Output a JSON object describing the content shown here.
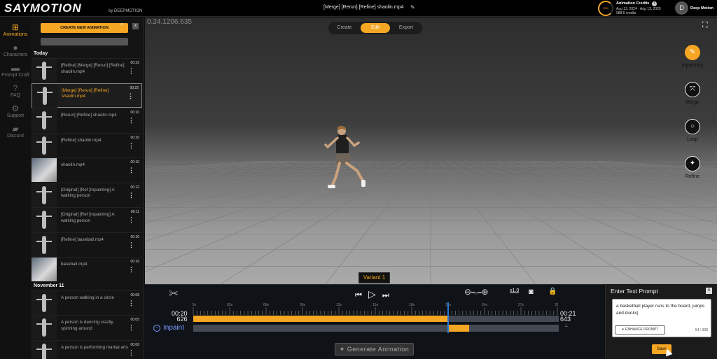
{
  "header": {
    "logo": "SAYMOTION",
    "logo_sub": "by DEEPMOTION",
    "filename": "[Merge] [Rerun] [Refine] shaolin.mp4",
    "credits": {
      "title": "Animation Credits",
      "ring_label": "99%",
      "date_range": "Aug 13, 2024 - Aug 13, 2025",
      "remaining": "988.5 credits"
    },
    "avatar_initial": "D",
    "username": "Deep Motion"
  },
  "left_nav": {
    "items": [
      {
        "label": "Animations",
        "icon": "plus-square-icon",
        "active": true
      },
      {
        "label": "Characters",
        "icon": "person-icon",
        "active": false
      },
      {
        "label": "Prompt Craft",
        "icon": "vr-headset-icon",
        "active": false
      },
      {
        "label": "FAQ",
        "icon": "question-icon",
        "active": false
      },
      {
        "label": "Support",
        "icon": "gear-icon",
        "active": false
      },
      {
        "label": "Discord",
        "icon": "chat-icon",
        "active": false
      }
    ]
  },
  "panel": {
    "create_button": "CREATE NEW ANIMATION",
    "close": "x",
    "search_placeholder": "",
    "groups": [
      {
        "label": "Today",
        "items": [
          {
            "title": "[Refine] [Merge] [Rerun] [Refine] shaolin.mp4",
            "time": "00:22",
            "thumb": "tpose",
            "selected": false
          },
          {
            "title": "[Merge] [Rerun] [Refine] shaolin.mp4",
            "time": "00:22",
            "thumb": "tpose",
            "selected": true
          },
          {
            "title": "[Rerun] [Refine] shaolin.mp4",
            "time": "00:10",
            "thumb": "tpose",
            "selected": false
          },
          {
            "title": "[Refine] shaolin.mp4",
            "time": "00:10",
            "thumb": "tpose",
            "selected": false
          },
          {
            "title": "shaolin.mp4",
            "time": "00:10",
            "thumb": "photo",
            "selected": false
          },
          {
            "title": "[Original] [Ref [Inpainting] A walking person",
            "time": "00:12",
            "thumb": "tpose",
            "selected": false
          },
          {
            "title": "[Original] [Ref [Inpainting] A walking person",
            "time": "00:11",
            "thumb": "tpose",
            "selected": false
          },
          {
            "title": "[Refine] baseball.mp4",
            "time": "00:16",
            "thumb": "tpose",
            "selected": false
          },
          {
            "title": "baseball.mp4",
            "time": "00:16",
            "thumb": "photo",
            "selected": false
          }
        ]
      },
      {
        "label": "November 11",
        "items": [
          {
            "title": "A person walking in a circle",
            "time": "00:08",
            "thumb": "tpose",
            "selected": false
          },
          {
            "title": "A person is dancing crazily, spinning around",
            "time": "00:05",
            "thumb": "tpose",
            "selected": false
          },
          {
            "title": "A person is performing martial arts",
            "time": "00:06",
            "thumb": "tpose",
            "selected": false
          }
        ]
      }
    ]
  },
  "viewport": {
    "coord": "0.24.1206.635",
    "mode_tabs": [
      {
        "label": "Create",
        "active": false
      },
      {
        "label": "Edit",
        "active": true
      },
      {
        "label": "Export",
        "active": false
      }
    ],
    "tools": [
      {
        "label": "Inpainting",
        "icon": "inpainting-icon",
        "active": true
      },
      {
        "label": "Merge",
        "icon": "merge-icon",
        "active": false
      },
      {
        "label": "Loop",
        "icon": "loop-icon",
        "active": false
      },
      {
        "label": "Refine",
        "icon": "wand-icon",
        "active": false
      }
    ]
  },
  "timeline": {
    "variant_label": "Variant 1",
    "start_time": "00:20",
    "start_frame": "626",
    "end_time": "00:21",
    "end_frame": "643",
    "speed": "x1.0",
    "inpaint_label": "Inpaint",
    "generate_button": "Generate Animation",
    "ruler_ticks": [
      "00s",
      "03s",
      "06s",
      "09s",
      "12s",
      "15s",
      "18s",
      "21s",
      "24s",
      "27s",
      "30s"
    ],
    "main_fill_fraction": 0.7,
    "inpaint_start_fraction": 0.695,
    "inpaint_end_fraction": 0.755,
    "playhead_fraction": 0.695,
    "colors": {
      "accent": "#f5a623",
      "track": "#454a52",
      "playhead": "#2e7bd6"
    }
  },
  "prompt": {
    "title": "Enter Text Prompt",
    "close": "x",
    "text": "a basketball player runs to the board, jumps and dunks|",
    "enhance_button": "ENHANCE PROMPT",
    "char_count": "54 / 308",
    "save_button": "Save"
  }
}
